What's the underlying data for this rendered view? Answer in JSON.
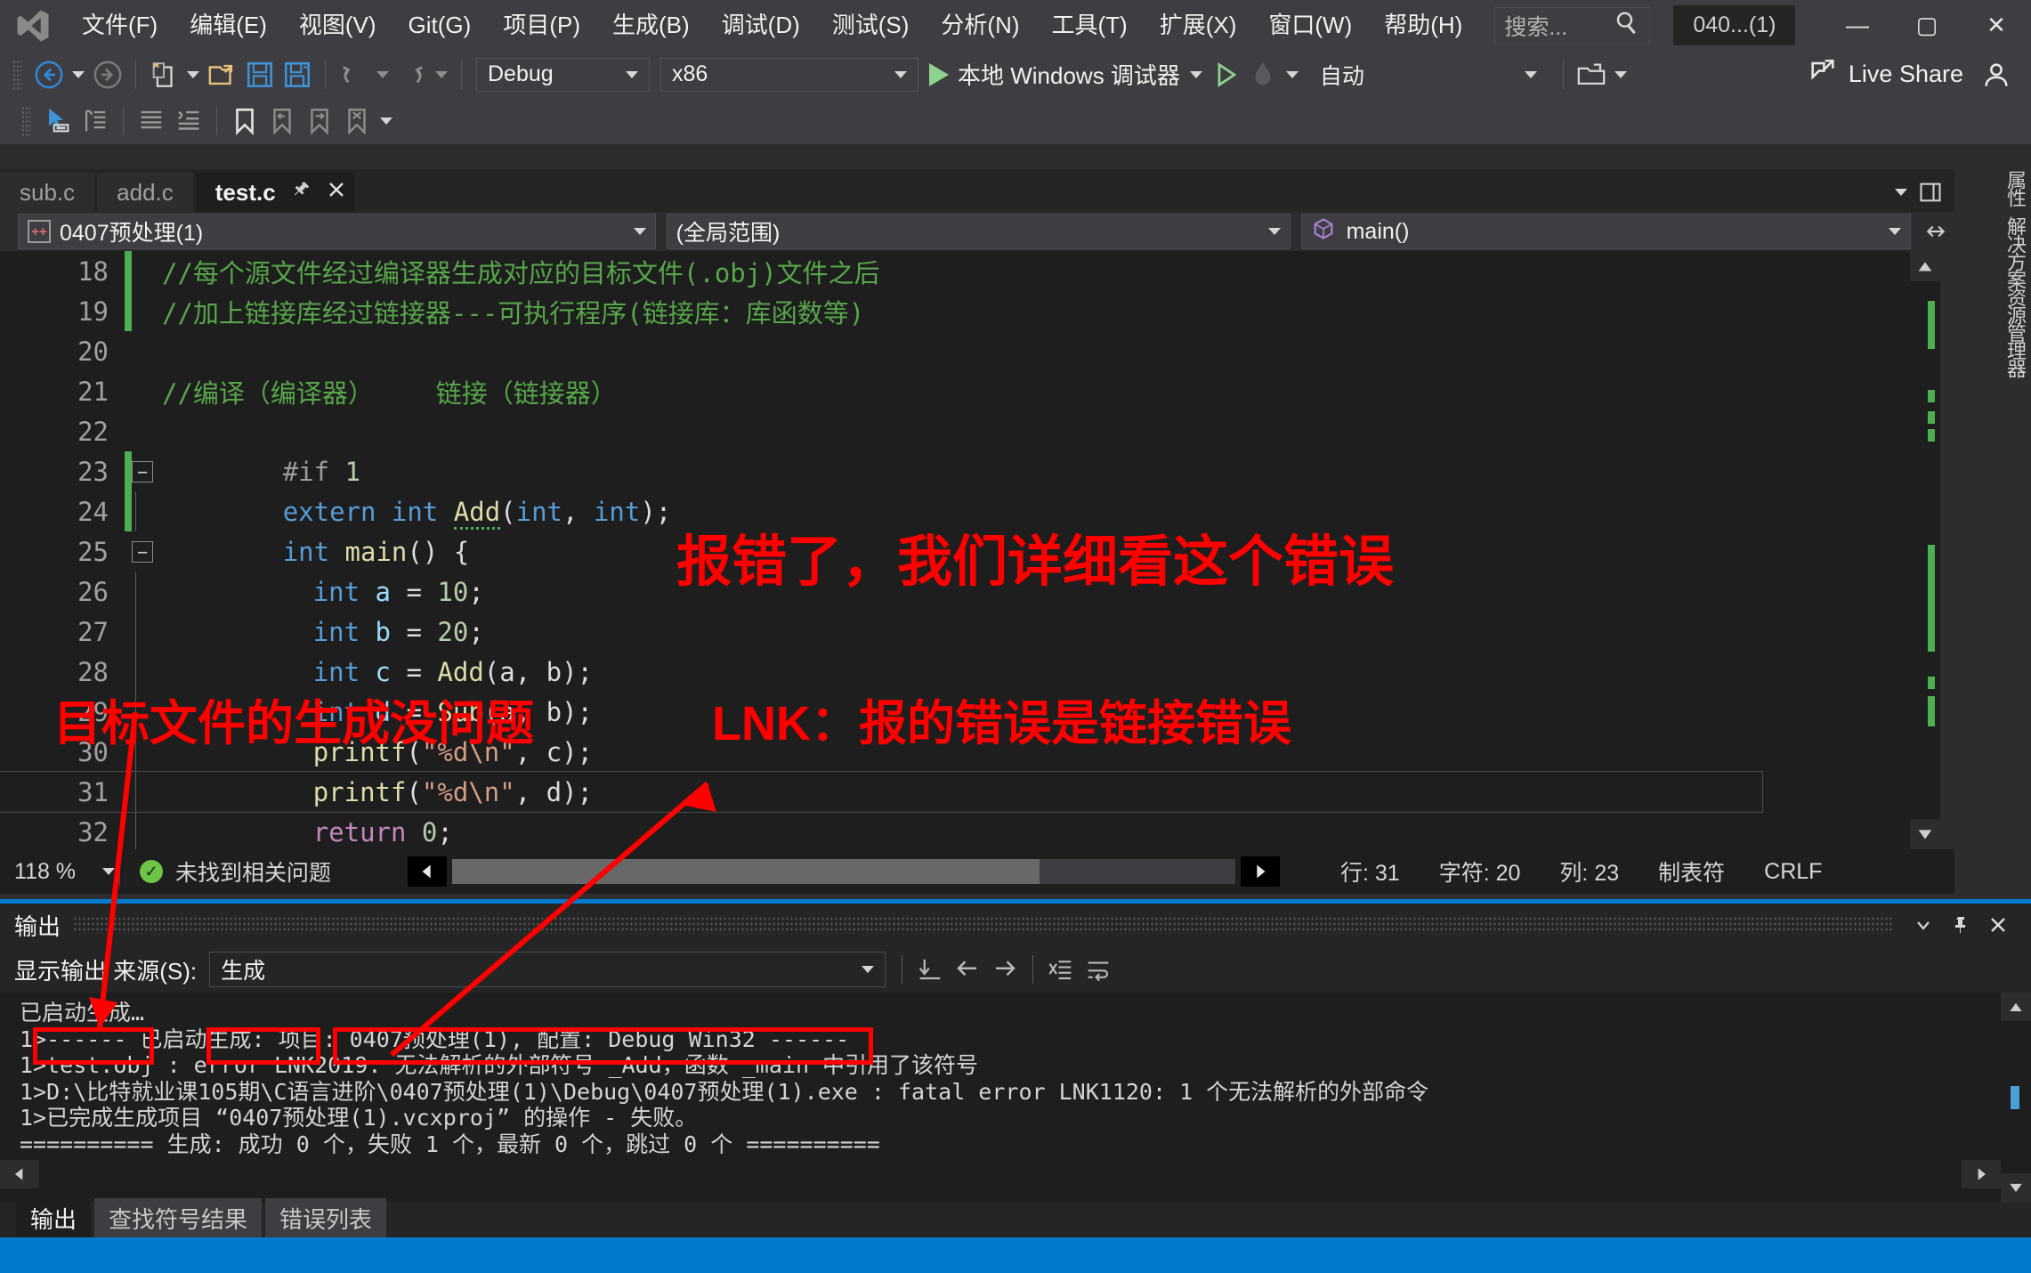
{
  "titlebar": {
    "logo": "visual-studio-logo",
    "menu": [
      "文件(F)",
      "编辑(E)",
      "视图(V)",
      "Git(G)",
      "项目(P)",
      "生成(B)",
      "调试(D)",
      "测试(S)",
      "分析(N)",
      "工具(T)",
      "扩展(X)",
      "窗口(W)",
      "帮助(H)"
    ],
    "search_placeholder": "搜索...",
    "doc_chip": "040...(1)",
    "minimize": "—",
    "maximize": "▢",
    "close": "✕"
  },
  "toolbar": {
    "config": "Debug",
    "platform": "x86",
    "debug_target": "本地 Windows 调试器",
    "auto": "自动",
    "live_share": "Live Share"
  },
  "tabs": [
    {
      "label": "sub.c",
      "active": false
    },
    {
      "label": "add.c",
      "active": false
    },
    {
      "label": "test.c",
      "active": true
    }
  ],
  "navbar": {
    "project": "0407预处理(1)",
    "scope": "(全局范围)",
    "member": "main()"
  },
  "editor": {
    "lines": [
      {
        "no": "18",
        "changed": true
      },
      {
        "no": "19",
        "changed": true
      },
      {
        "no": "20",
        "changed": false
      },
      {
        "no": "21",
        "changed": false
      },
      {
        "no": "22",
        "changed": false
      },
      {
        "no": "23",
        "changed": true
      },
      {
        "no": "24",
        "changed": true
      },
      {
        "no": "25",
        "changed": false
      },
      {
        "no": "26",
        "changed": false
      },
      {
        "no": "27",
        "changed": false
      },
      {
        "no": "28",
        "changed": false
      },
      {
        "no": "29",
        "changed": false
      },
      {
        "no": "30",
        "changed": false
      },
      {
        "no": "31",
        "changed": false
      },
      {
        "no": "32",
        "changed": false
      }
    ],
    "code": {
      "l18": "//每个源文件经过编译器生成对应的目标文件(.obj)文件之后",
      "l19": "//加上链接库经过链接器---可执行程序(链接库：库函数等)",
      "l20": "",
      "l21": "//编译（编译器）    链接（链接器）",
      "l22": "",
      "l23_pp": "#if",
      "l23_num": "1",
      "l24_kw1": "extern",
      "l24_kw2": "int",
      "l24_fn": "Add",
      "l24_rest_a": "(",
      "l24_kw3": "int",
      "l24_comma": ", ",
      "l24_kw4": "int",
      "l24_rest_b": ");",
      "l25_kw": "int",
      "l25_fn": "main",
      "l25_rest": "() {",
      "l26_kw": "int",
      "l26_var": "a",
      "l26_eq": " = ",
      "l26_num": "10",
      "l26_semi": ";",
      "l27_kw": "int",
      "l27_var": "b",
      "l27_num": "20",
      "l28_kw": "int",
      "l28_var": "c",
      "l28_fn": "Add",
      "l28_args": "(a, b);",
      "l29_kw": "int",
      "l29_var": "d",
      "l29_fn": "Sub",
      "l29_args": "(a, b);",
      "l30_fn": "printf",
      "l30_str": "\"%d\\n\"",
      "l30_args": ", c);",
      "l31_fn": "printf",
      "l31_str": "\"%d\\n\"",
      "l31_args": ", d);",
      "l32_ret": "return",
      "l32_num": "0",
      "l32_semi": ";"
    }
  },
  "editor_status": {
    "zoom": "118 %",
    "issues": "未找到相关问题",
    "issues_icon": "check-circle-icon",
    "line": "行: 31",
    "chars": "字符: 20",
    "col": "列: 23",
    "tabs_mode": "制表符",
    "eol": "CRLF"
  },
  "output": {
    "panel_title": "输出",
    "source_label": "显示输出 来源(S):",
    "source_value": "生成",
    "lines": [
      "已启动生成…",
      "1>------ 已启动生成: 项目: 0407预处理(1), 配置: Debug Win32 ------",
      "1>test.obj : error LNK2019: 无法解析的外部符号 _Add，函数 _main 中引用了该符号",
      "1>D:\\比特就业课105期\\C语言进阶\\0407预处理(1)\\Debug\\0407预处理(1).exe : fatal error LNK1120: 1 个无法解析的外部命令",
      "1>已完成生成项目 “0407预处理(1).vcxproj” 的操作 - 失败。",
      "========== 生成: 成功 0 个，失败 1 个，最新 0 个，跳过 0 个 =========="
    ],
    "tabs": [
      {
        "label": "输出",
        "active": true
      },
      {
        "label": "查找符号结果",
        "active": false
      },
      {
        "label": "错误列表",
        "active": false
      }
    ]
  },
  "right_dock": {
    "properties": "属性",
    "solution_explorer": "解决方案资源管理器"
  },
  "annotations": {
    "note1": "报错了，我们详细看这个错误",
    "note2": "目标文件的生成没问题",
    "note3": "LNK：报的错误是链接错误",
    "color": "#ff0000"
  }
}
